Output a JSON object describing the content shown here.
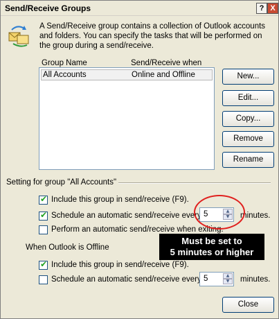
{
  "window": {
    "title": "Send/Receive Groups",
    "help_button": "?",
    "close_button": "X"
  },
  "intro_text": "A Send/Receive group contains a collection of Outlook accounts and folders. You can specify the tasks that will be performed on the group during a send/receive.",
  "groups_list": {
    "headers": {
      "name": "Group Name",
      "when": "Send/Receive when"
    },
    "rows": [
      {
        "name": "All Accounts",
        "when": "Online and Offline"
      }
    ]
  },
  "buttons": {
    "new": "New...",
    "edit": "Edit...",
    "copy": "Copy...",
    "remove": "Remove",
    "rename": "Rename",
    "close": "Close"
  },
  "settings_section": {
    "title": "Setting for group \"All Accounts\"",
    "online": {
      "include": {
        "label": "Include this group in send/receive (F9).",
        "checked": true
      },
      "schedule": {
        "label_before": "Schedule an automatic send/receive every",
        "value": "5",
        "label_after": "minutes.",
        "checked": true
      },
      "perform_on_exit": {
        "label": "Perform an automatic send/receive when exiting.",
        "checked": false
      }
    },
    "offline_heading": "When Outlook is Offline",
    "offline": {
      "include": {
        "label": "Include this group in send/receive (F9).",
        "checked": true
      },
      "schedule": {
        "label_before": "Schedule an automatic send/receive every",
        "value": "5",
        "label_after": "minutes.",
        "checked": false
      }
    }
  },
  "annotation": {
    "line1": "Must be set to",
    "line2": "5 minutes or higher",
    "circle_color": "#e0201e"
  },
  "colors": {
    "dialog_bg": "#ece9d8",
    "button_border": "#003c74",
    "check_mark": "#21a121"
  }
}
